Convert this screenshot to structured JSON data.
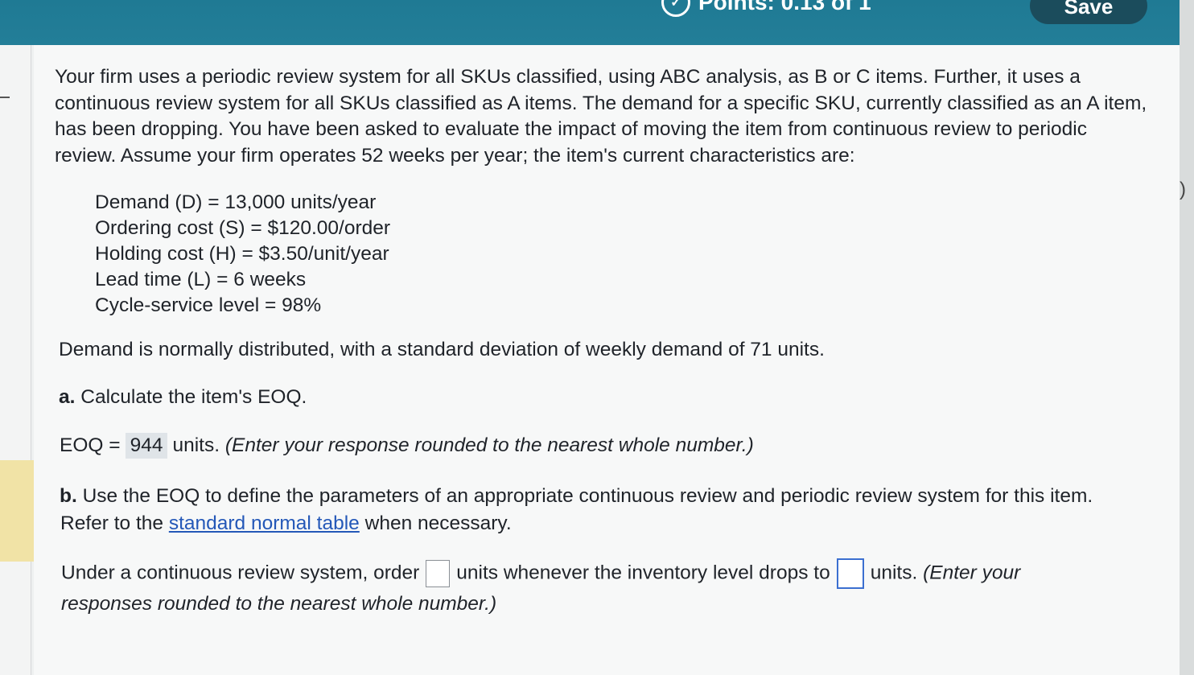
{
  "header": {
    "points_label": "Points: 0.13 of 1",
    "save_label": "Save"
  },
  "problem": {
    "intro": "Your firm uses a periodic review system for all SKUs classified, using ABC analysis, as B or C items. Further, it uses a continuous review system for all SKUs classified as A items. The demand for a specific SKU, currently classified as an A item, has been dropping. You have been asked to evaluate the impact of moving the item from continuous review to periodic review. Assume your firm operates 52 weeks per year; the item's current characteristics are:",
    "parameters": [
      "Demand (D) = 13,000 units/year",
      "Ordering cost (S) = $120.00/order",
      "Holding cost (H) = $3.50/unit/year",
      "Lead time (L) = 6 weeks",
      "Cycle-service level = 98%"
    ],
    "demand_note": "Demand is normally distributed, with a standard deviation of weekly demand of 71 units."
  },
  "part_a": {
    "letter": "a.",
    "text": "Calculate the item's EOQ.",
    "eoq_prefix": "EOQ =",
    "eoq_value": "944",
    "eoq_units": "units.",
    "eoq_hint": "(Enter your response rounded to the nearest whole number.)"
  },
  "part_b": {
    "letter": "b.",
    "text": "Use the EOQ to define the parameters of an appropriate continuous review and periodic review system for this item.",
    "refer_prefix": "Refer to the",
    "link_text": "standard normal table",
    "refer_suffix": "when necessary.",
    "cr_prefix": "Under a continuous review system, order",
    "cr_middle": "units whenever the inventory level drops to",
    "cr_suffix": "units.",
    "cr_hint_1": "(Enter your",
    "cr_hint_2": "responses rounded to the nearest whole number.)",
    "order_qty_value": "",
    "reorder_point_value": ""
  }
}
